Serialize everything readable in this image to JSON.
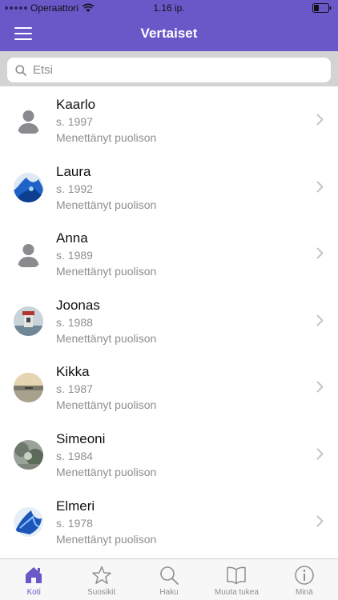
{
  "status_bar": {
    "carrier": "Operaattori",
    "time": "1.16 ip.",
    "icons": [
      "signal-dots-icon",
      "wifi-icon",
      "battery-icon"
    ]
  },
  "nav": {
    "title": "Vertaiset",
    "menu_icon": "hamburger-menu-icon"
  },
  "search": {
    "placeholder": "Etsi",
    "value": ""
  },
  "peers": [
    {
      "name": "Kaarlo",
      "year": "s. 1997",
      "status": "Menettänyt puolison",
      "avatar": "default-silhouette"
    },
    {
      "name": "Laura",
      "year": "s. 1992",
      "status": "Menettänyt puolison",
      "avatar": "photo-blue-art"
    },
    {
      "name": "Anna",
      "year": "s. 1989",
      "status": "Menettänyt puolison",
      "avatar": "default-silhouette"
    },
    {
      "name": "Joonas",
      "year": "s. 1988",
      "status": "Menettänyt puolison",
      "avatar": "photo-lighthouse"
    },
    {
      "name": "Kikka",
      "year": "s. 1987",
      "status": "Menettänyt puolison",
      "avatar": "photo-sunset-lake"
    },
    {
      "name": "Simeoni",
      "year": "s. 1984",
      "status": "Menettänyt puolison",
      "avatar": "photo-nature"
    },
    {
      "name": "Elmeri",
      "year": "s. 1978",
      "status": "Menettänyt puolison",
      "avatar": "photo-blue-art"
    }
  ],
  "tabs": [
    {
      "label": "Koti",
      "icon": "home-icon",
      "active": true
    },
    {
      "label": "Suosikit",
      "icon": "star-icon",
      "active": false
    },
    {
      "label": "Haku",
      "icon": "search-icon",
      "active": false
    },
    {
      "label": "Muuta tukea",
      "icon": "book-icon",
      "active": false
    },
    {
      "label": "Minä",
      "icon": "info-icon",
      "active": false
    }
  ],
  "colors": {
    "accent": "#6a57c8",
    "secondary_text": "#8e8e93",
    "tab_inactive": "#8e8e93"
  }
}
